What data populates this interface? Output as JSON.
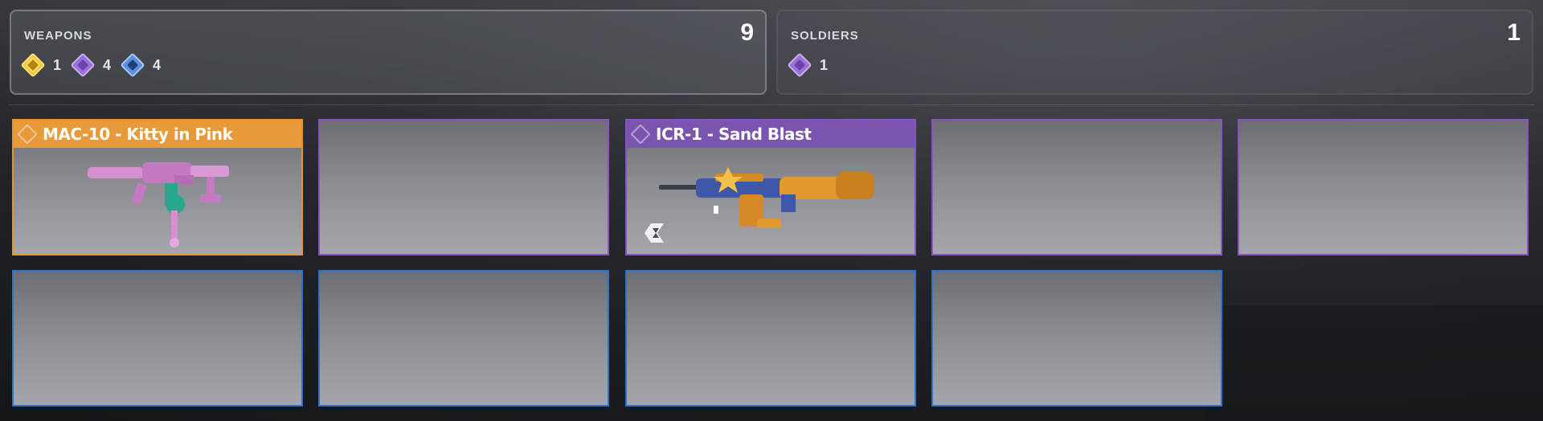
{
  "panels": {
    "weapons": {
      "title": "WEAPONS",
      "count": "9",
      "rarities": [
        {
          "tier": "gold",
          "icon": "gold-rarity-icon",
          "count": "1"
        },
        {
          "tier": "purple",
          "icon": "purple-rarity-icon",
          "count": "4"
        },
        {
          "tier": "blue",
          "icon": "blue-rarity-icon",
          "count": "4"
        }
      ]
    },
    "soldiers": {
      "title": "SOLDIERS",
      "count": "1",
      "rarities": [
        {
          "tier": "purple",
          "icon": "purple-rarity-icon",
          "count": "1"
        }
      ]
    }
  },
  "slots": [
    {
      "rarity": "gold",
      "name": "MAC-10 - Kitty in Pink",
      "icon": "mac10-pink-weapon-icon"
    },
    {
      "rarity": "purple",
      "name": "",
      "icon": ""
    },
    {
      "rarity": "purple",
      "name": "ICR-1 - Sand Blast",
      "icon": "icr1-sand-blast-weapon-icon"
    },
    {
      "rarity": "purple",
      "name": "",
      "icon": ""
    },
    {
      "rarity": "purple",
      "name": "",
      "icon": ""
    },
    {
      "rarity": "blue",
      "name": "",
      "icon": ""
    },
    {
      "rarity": "blue",
      "name": "",
      "icon": ""
    },
    {
      "rarity": "blue",
      "name": "",
      "icon": ""
    },
    {
      "rarity": "blue",
      "name": "",
      "icon": ""
    }
  ],
  "colors": {
    "gold": "#e8993a",
    "purple": "#8a52c8",
    "blue": "#2f72c9"
  }
}
